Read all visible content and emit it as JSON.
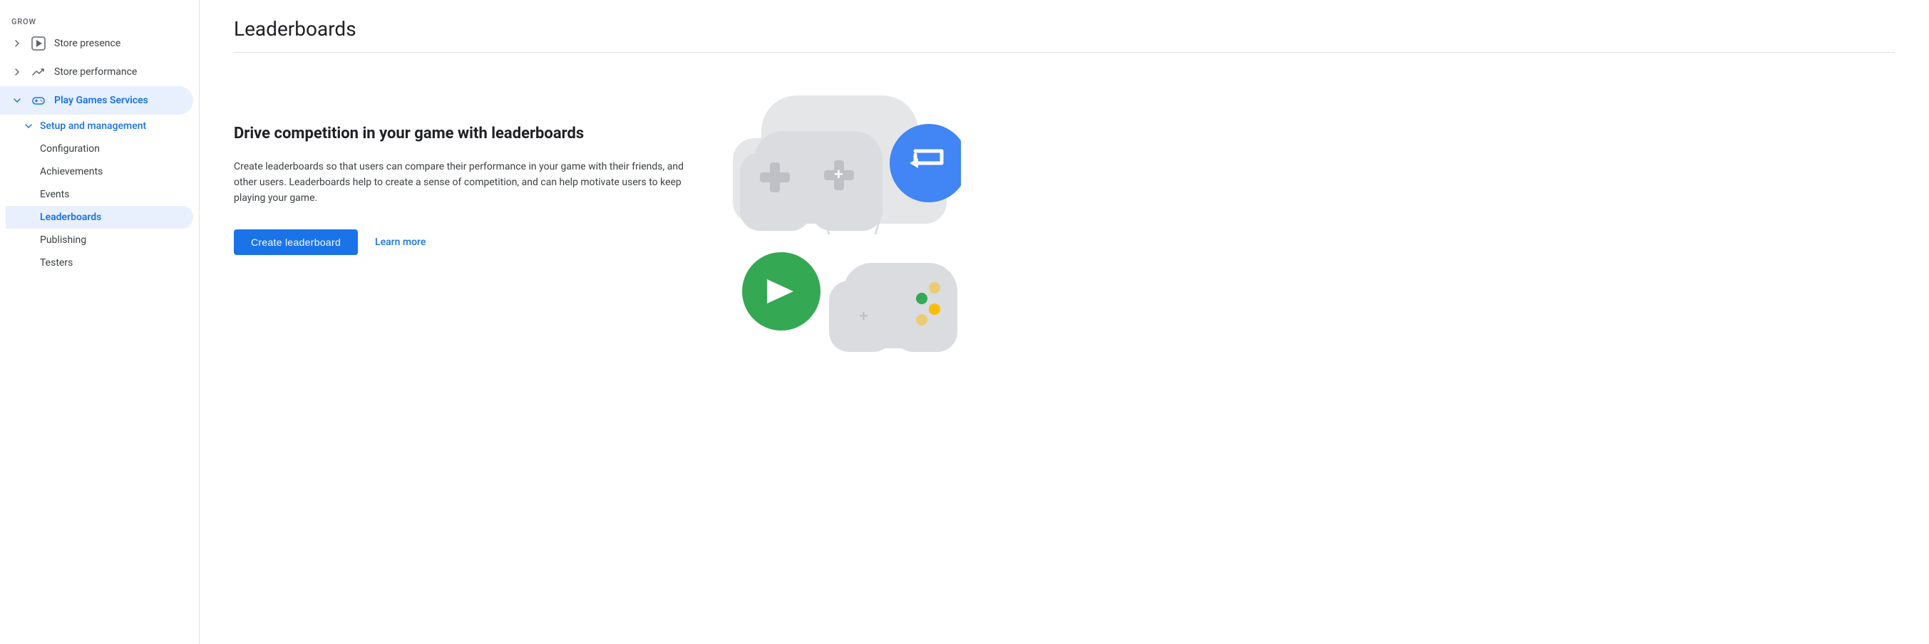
{
  "sidebar": {
    "grow_label": "Grow",
    "items": [
      {
        "id": "store-presence",
        "label": "Store presence",
        "icon": "play-icon",
        "active": false,
        "expanded": false
      },
      {
        "id": "store-performance",
        "label": "Store performance",
        "icon": "trending-icon",
        "active": false,
        "expanded": false
      },
      {
        "id": "play-games-services",
        "label": "Play Games Services",
        "icon": "gamepad-icon",
        "active": true,
        "expanded": true
      }
    ],
    "sub_menu": {
      "header": "Setup and management",
      "items": [
        {
          "id": "configuration",
          "label": "Configuration",
          "active": false
        },
        {
          "id": "achievements",
          "label": "Achievements",
          "active": false
        },
        {
          "id": "events",
          "label": "Events",
          "active": false
        },
        {
          "id": "leaderboards",
          "label": "Leaderboards",
          "active": true
        },
        {
          "id": "publishing",
          "label": "Publishing",
          "active": false
        },
        {
          "id": "testers",
          "label": "Testers",
          "active": false
        }
      ]
    }
  },
  "main": {
    "page_title": "Leaderboards",
    "content_heading": "Drive competition in your game with leaderboards",
    "content_description": "Create leaderboards so that users can compare their performance in your game with their friends, and other users. Leaderboards help to create a sense of competition, and can help motivate users to keep playing your game.",
    "create_button": "Create leaderboard",
    "learn_more_link": "Learn more"
  }
}
